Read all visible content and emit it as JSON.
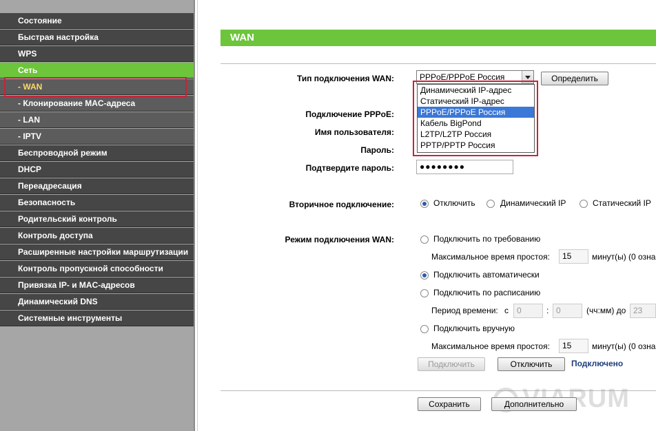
{
  "sidebar": {
    "items": [
      {
        "label": "Состояние"
      },
      {
        "label": "Быстрая настройка"
      },
      {
        "label": "WPS"
      },
      {
        "label": "Сеть"
      },
      {
        "label": "- WAN"
      },
      {
        "label": "- Клонирование MAC-адреса"
      },
      {
        "label": "- LAN"
      },
      {
        "label": "- IPTV"
      },
      {
        "label": "Беспроводной режим"
      },
      {
        "label": "DHCP"
      },
      {
        "label": "Переадресация"
      },
      {
        "label": "Безопасность"
      },
      {
        "label": "Родительский контроль"
      },
      {
        "label": "Контроль доступа"
      },
      {
        "label": "Расширенные настройки маршрутизации"
      },
      {
        "label": "Контроль пропускной способности"
      },
      {
        "label": "Привязка IP- и MAC-адресов"
      },
      {
        "label": "Динамический DNS"
      },
      {
        "label": "Системные инструменты"
      }
    ]
  },
  "page": {
    "title": "WAN"
  },
  "form": {
    "wan_type_label": "Тип подключения WAN:",
    "wan_type_value": "PPPoE/PPPoE Россия",
    "detect_button": "Определить",
    "wan_type_options": [
      "Динамический IP-адрес",
      "Статический IP-адрес",
      "PPPoE/PPPoE Россия",
      "Кабель BigPond",
      "L2TP/L2TP Россия",
      "PPTP/PPTP Россия"
    ],
    "pppoe_label": "Подключение PPPoE:",
    "username_label": "Имя пользователя:",
    "password_label": "Пароль:",
    "confirm_password_label": "Подтвердите пароль:",
    "confirm_password_value": "●●●●●●●●",
    "secondary_label": "Вторичное подключение:",
    "secondary_options": [
      "Отключить",
      "Динамический IP",
      "Статический IP"
    ],
    "mode_label": "Режим подключения WAN:",
    "mode_on_demand": "Подключить по требованию",
    "max_idle_label": "Максимальное время простоя:",
    "max_idle_value_1": "15",
    "minutes_suffix_1": "минут(ы) (0 озна",
    "mode_auto": "Подключить автоматически",
    "mode_schedule": "Подключить по расписанию",
    "period_label": "Период времени:",
    "period_from_prefix": "с",
    "period_from_h": "0",
    "period_colon": ":",
    "period_from_m": "0",
    "period_format": "(чч:мм) до",
    "period_to_h": "23",
    "mode_manual": "Подключить вручную",
    "max_idle_value_2": "15",
    "minutes_suffix_2": "минут(ы) (0 озна",
    "connect_button": "Подключить",
    "disconnect_button": "Отключить",
    "status": "Подключено"
  },
  "footer": {
    "save_button": "Сохранить",
    "advanced_button": "Дополнительно"
  },
  "watermark": "VIARUM",
  "colors": {
    "accent": "#6cc53a",
    "highlight_border": "#c4243a",
    "sidebar_bg": "#464646",
    "selection": "#3b78d7"
  }
}
